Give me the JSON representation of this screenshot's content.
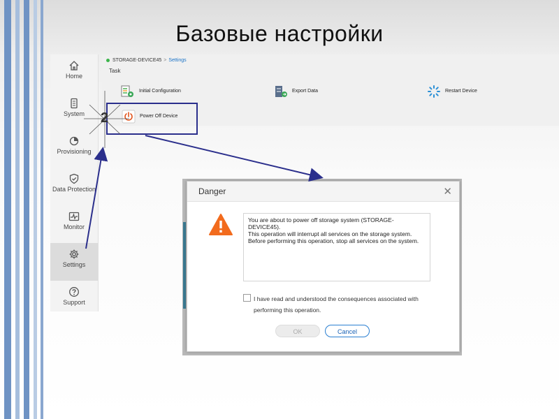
{
  "slide": {
    "title": "Базовые настройки"
  },
  "annotation": {
    "step_number": "2"
  },
  "sidebar": {
    "items": [
      {
        "label": "Home",
        "icon": "home-icon"
      },
      {
        "label": "System",
        "icon": "system-icon"
      },
      {
        "label": "Provisioning",
        "icon": "provisioning-icon"
      },
      {
        "label": "Data Protection",
        "icon": "shield-icon"
      },
      {
        "label": "Monitor",
        "icon": "monitor-icon"
      },
      {
        "label": "Settings",
        "icon": "gear-icon",
        "active": true
      },
      {
        "label": "Support",
        "icon": "question-icon"
      }
    ]
  },
  "panel": {
    "breadcrumb": {
      "device": "STORAGE-DEVICE45",
      "separator": ">",
      "current": "Settings"
    },
    "task_label": "Task",
    "tasks": [
      {
        "label": "Initial Configuration",
        "icon": "initial-configuration-icon"
      },
      {
        "label": "Export Data",
        "icon": "export-data-icon"
      },
      {
        "label": "Restart Device",
        "icon": "restart-icon"
      },
      {
        "label": "Power Off Device",
        "icon": "power-icon"
      }
    ]
  },
  "dialog": {
    "title": "Danger",
    "close": "✕",
    "message": [
      "You are about to power off storage system (STORAGE-DEVICE45).",
      "This operation will interrupt all services on the storage system.",
      "Before performing this operation, stop all services on the system."
    ],
    "checkbox_label": "I have read and understood the consequences associated with performing this operation.",
    "ok_label": "OK",
    "cancel_label": "Cancel"
  },
  "colors": {
    "accent": "#1a62b5",
    "warning": "#f26b1d",
    "status_dot": "#3bb44a",
    "annotation": "#2b2f8c"
  }
}
